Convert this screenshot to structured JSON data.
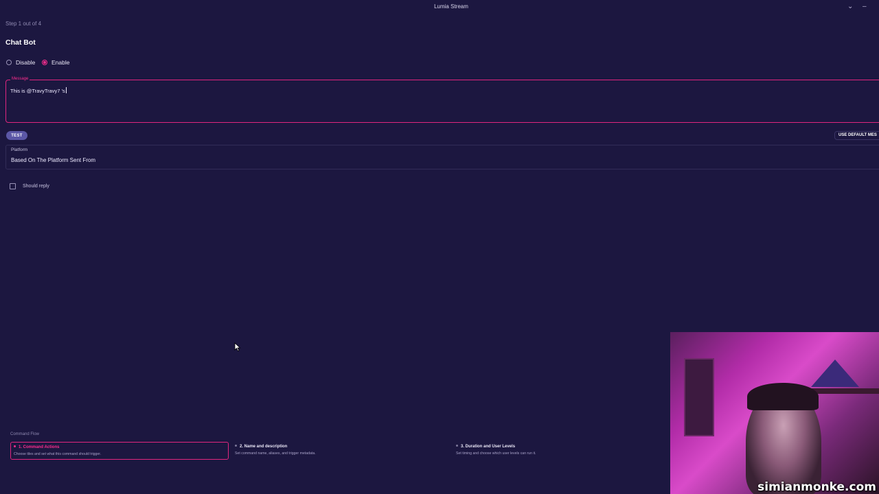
{
  "window": {
    "title": "Lumia Stream",
    "minimize_glyph": "⌄",
    "dash_glyph": "–"
  },
  "form": {
    "step": "Step 1 out of 4",
    "section_title": "Chat Bot",
    "radios": [
      {
        "label": "Disable",
        "selected": false
      },
      {
        "label": "Enable",
        "selected": true
      }
    ],
    "message": {
      "legend": "Message",
      "value": "This is @TravyTravy7 's"
    },
    "test_label": "TEST",
    "default_label": "USE DEFAULT MES",
    "platform": {
      "label": "Platform",
      "value": "Based On The Platform Sent From"
    },
    "should_reply": {
      "label": "Should reply",
      "checked": false
    }
  },
  "command_flow": {
    "title": "Command Flow",
    "steps": [
      {
        "title": "1. Command Actions",
        "desc": "Choose tiles and set what this command should trigger.",
        "active": true
      },
      {
        "title": "2. Name and description",
        "desc": "Set command name, aliases, and trigger metadata.",
        "active": false
      },
      {
        "title": "3. Duration and User Levels",
        "desc": "Set timing and choose which user levels can run it.",
        "active": false
      }
    ]
  },
  "webcam": {
    "watermark": "simianmonke.com"
  },
  "colors": {
    "background": "#1c1740",
    "accent": "#ff2d8e",
    "button": "#5b57a6"
  }
}
